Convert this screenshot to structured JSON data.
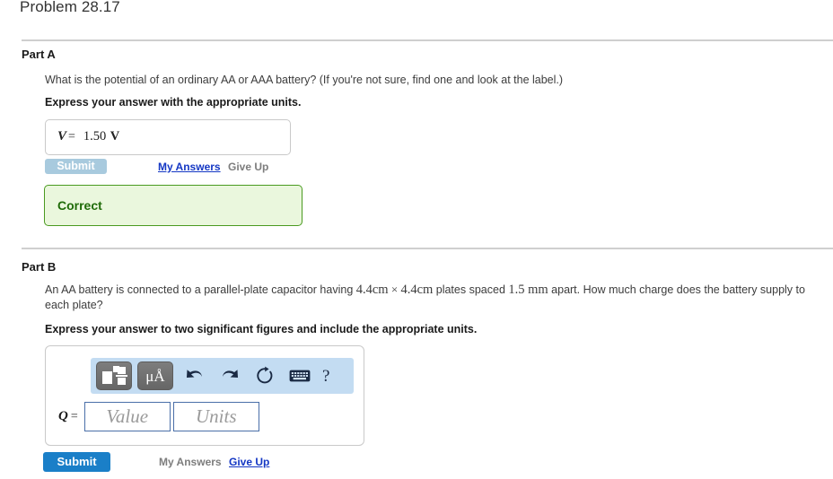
{
  "problem": {
    "title": "Problem 28.17"
  },
  "part_a": {
    "label": "Part A",
    "question_pre": "What is the potential of an ordinary AA or AAA battery? (If you're not sure, find one and look at the label.)",
    "instruction": "Express your answer with the appropriate units.",
    "answer": {
      "variable": "V",
      "equals": "=",
      "value": "1.50",
      "unit": "V"
    },
    "submit_label": "Submit",
    "my_answers_label": "My Answers",
    "give_up_label": "Give Up",
    "feedback": "Correct"
  },
  "part_b": {
    "label": "Part B",
    "question": {
      "seg1": "An AA battery is connected to a parallel-plate capacitor having ",
      "dim1": "4.4cm",
      "times": "×",
      "dim2": "4.4cm",
      "seg2": " plates spaced ",
      "gap": "1.5 mm",
      "seg3": " apart. How much charge does the battery supply to each plate?"
    },
    "instruction": "Express your answer to two significant figures and include the appropriate units.",
    "toolbar": {
      "template_button": "math-template",
      "units_button": "μÅ",
      "undo": "undo",
      "redo": "redo",
      "reset": "reset",
      "keyboard": "keyboard",
      "help": "?"
    },
    "answer": {
      "variable": "Q",
      "equals": "=",
      "value_placeholder": "Value",
      "units_placeholder": "Units"
    },
    "submit_label": "Submit",
    "my_answers_label": "My Answers",
    "give_up_label": "Give Up"
  },
  "colors": {
    "submit_active": "#1a7fc8",
    "submit_disabled": "#a8cade",
    "link": "#1437c4",
    "muted_text": "#7d7d7d",
    "correct_bg": "#eaf7dd",
    "correct_border": "#4a9a20",
    "correct_text": "#1f6b08",
    "toolbar_bg": "#c3dcf2",
    "field_border": "#4a6fa8"
  }
}
